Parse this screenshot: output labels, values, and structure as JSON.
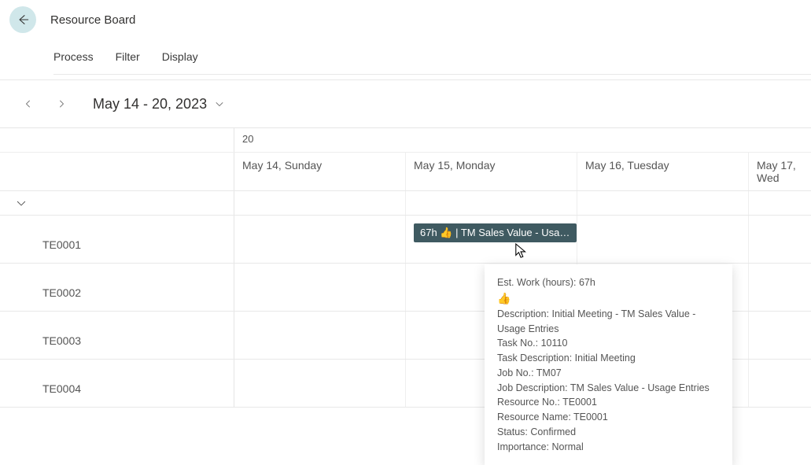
{
  "header": {
    "title": "Resource Board"
  },
  "toolbar": {
    "process": "Process",
    "filter": "Filter",
    "display": "Display"
  },
  "datebar": {
    "range": "May 14 - 20, 2023"
  },
  "columns": {
    "week": "20",
    "d0": "May 14, Sunday",
    "d1": "May 15, Monday",
    "d2": "May 16, Tuesday",
    "d3": "May 17, Wed"
  },
  "resources": {
    "r0": "TE0001",
    "r1": "TE0002",
    "r2": "TE0003",
    "r3": "TE0004"
  },
  "task": {
    "label": "67h 👍 | TM Sales Value - Usage..."
  },
  "tooltip": {
    "est": "Est. Work (hours): 67h",
    "emoji": "👍",
    "desc": "Description: Initial Meeting - TM Sales Value - Usage Entries",
    "taskno": "Task No.: 10110",
    "taskdesc": "Task Description: Initial Meeting",
    "jobno": "Job No.: TM07",
    "jobdesc": "Job Description: TM Sales Value - Usage Entries",
    "resno": "Resource No.: TE0001",
    "resname": "Resource Name: TE0001",
    "status": "Status: Confirmed",
    "importance": "Importance: Normal"
  }
}
